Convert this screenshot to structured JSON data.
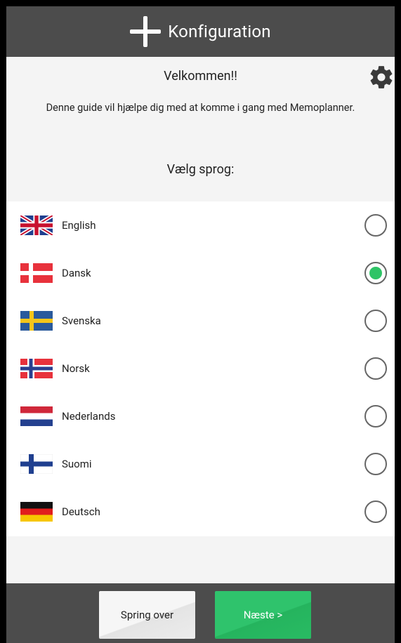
{
  "header": {
    "title": "Konfiguration",
    "icon": "plus-icon"
  },
  "welcome": {
    "heading": "Velkommen!!",
    "description": "Denne guide vil hjælpe dig med at komme i gang med Memoplanner.",
    "choose_language": "Vælg sprog:",
    "settings_icon": "gear-icon"
  },
  "languages": [
    {
      "label": "English",
      "flag": "uk-flag-icon",
      "selected": false
    },
    {
      "label": "Dansk",
      "flag": "denmark-flag-icon",
      "selected": true
    },
    {
      "label": "Svenska",
      "flag": "sweden-flag-icon",
      "selected": false
    },
    {
      "label": "Norsk",
      "flag": "norway-flag-icon",
      "selected": false
    },
    {
      "label": "Nederlands",
      "flag": "netherlands-flag-icon",
      "selected": false
    },
    {
      "label": "Suomi",
      "flag": "finland-flag-icon",
      "selected": false
    },
    {
      "label": "Deutsch",
      "flag": "germany-flag-icon",
      "selected": false
    }
  ],
  "footer": {
    "skip_label": "Spring over",
    "next_label": "Næste >"
  },
  "colors": {
    "bar": "#4c4c4c",
    "accent_green": "#2ec466",
    "background": "#f4f4f4"
  }
}
